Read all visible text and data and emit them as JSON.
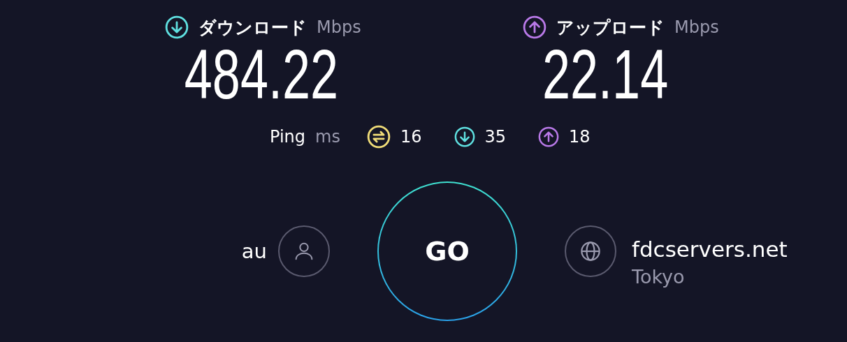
{
  "download": {
    "label": "ダウンロード",
    "unit": "Mbps",
    "value": "484.22",
    "color": "#5fe0e0"
  },
  "upload": {
    "label": "アップロード",
    "unit": "Mbps",
    "value": "22.14",
    "color": "#b979e8"
  },
  "ping": {
    "label": "Ping",
    "unit": "ms",
    "items": [
      {
        "kind": "idle",
        "value": "16",
        "color": "#f0dc78"
      },
      {
        "kind": "download",
        "value": "35",
        "color": "#5fe0e0"
      },
      {
        "kind": "upload",
        "value": "18",
        "color": "#b979e8"
      }
    ]
  },
  "provider": {
    "name": "au"
  },
  "go_button": {
    "label": "GO"
  },
  "server": {
    "name": "fdcservers.net",
    "location": "Tokyo"
  }
}
